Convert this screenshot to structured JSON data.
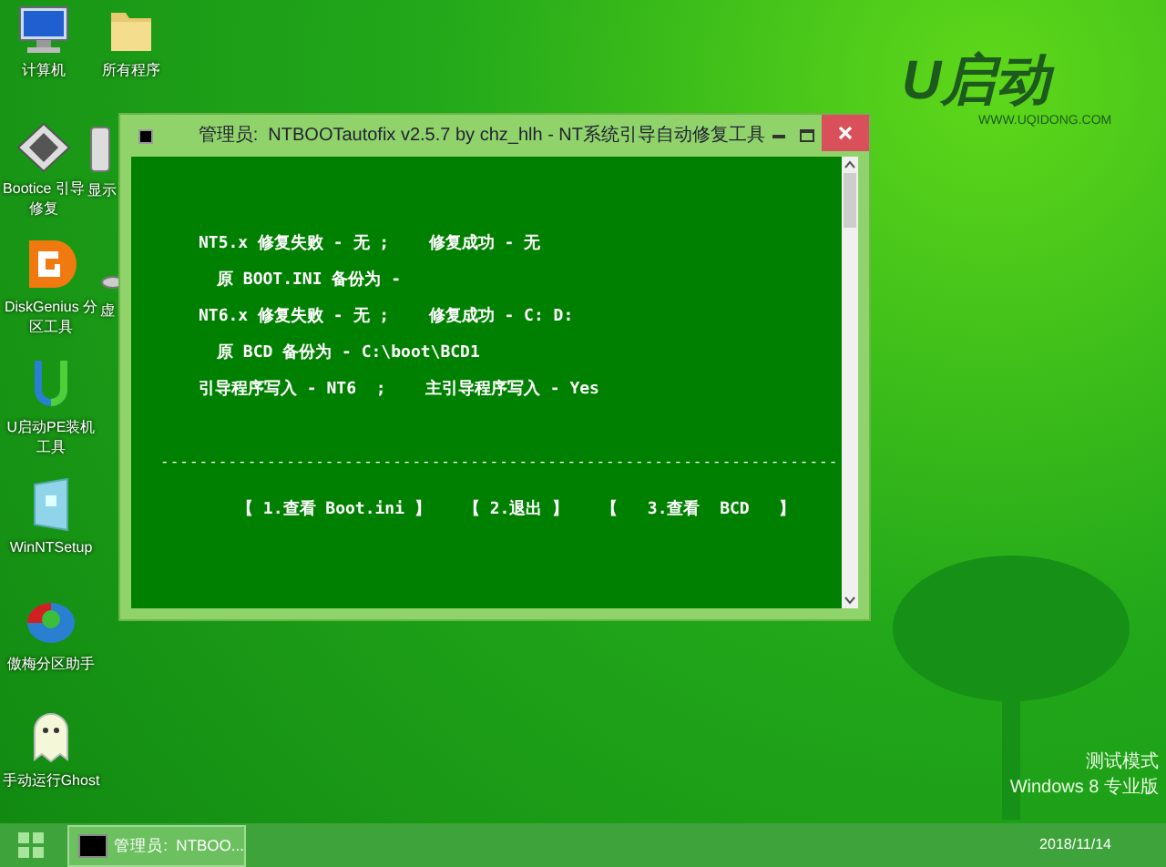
{
  "desktop_icons": [
    {
      "label": "计算机",
      "kind": "computer"
    },
    {
      "label": "所有程序",
      "kind": "folder"
    },
    {
      "label": "Bootice 引导修复",
      "kind": "floppy"
    },
    {
      "label": "显示",
      "kind": "drive"
    },
    {
      "label": "DiskGenius 分区工具",
      "kind": "diskgenius"
    },
    {
      "label": "虚",
      "kind": "disc"
    },
    {
      "label": "U启动PE装机工具",
      "kind": "ulogo"
    },
    {
      "label": "WinNTSetup",
      "kind": "setup"
    },
    {
      "label": "傲梅分区助手",
      "kind": "partition"
    },
    {
      "label": "手动运行Ghost",
      "kind": "ghost"
    }
  ],
  "logo": {
    "text": "U启动",
    "url": "WWW.UQIDONG.COM"
  },
  "window": {
    "title": "管理员:  NTBOOTautofix v2.5.7 by chz_hlh - NT系统引导自动修复工具",
    "console_lines": [
      {
        "text": "NT5.x 修复失败 - 无 ;    修复成功 - 无",
        "kind": "plain"
      },
      {
        "text": "原 BOOT.INI 备份为 -",
        "kind": "indented"
      },
      {
        "text": "NT6.x 修复失败 - 无 ;    修复成功 - C: D:",
        "kind": "plain"
      },
      {
        "text": "原 BCD 备份为 - C:\\boot\\BCD1",
        "kind": "indented"
      },
      {
        "text": "引导程序写入 - NT6  ;    主引导程序写入 - Yes",
        "kind": "plain"
      }
    ],
    "separator": "----------------------------------------------------------------------",
    "menu": [
      "【 1.查看 Boot.ini 】",
      "【 2.退出 】",
      "【   3.查看  BCD   】"
    ]
  },
  "system_notice": [
    "测试模式",
    "Windows 8 专业版"
  ],
  "taskbar": {
    "tasks": [
      {
        "label": "管理员:  NTBOO...",
        "selected": true
      }
    ],
    "date": "2018/11/14"
  }
}
